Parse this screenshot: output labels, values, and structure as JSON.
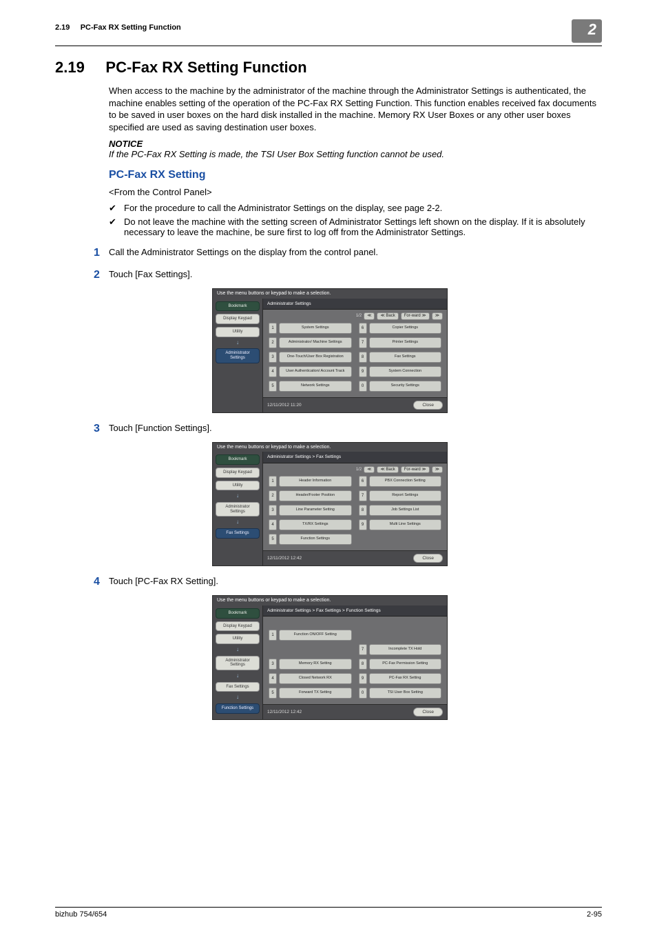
{
  "running_head": {
    "section_no": "2.19",
    "title": "PC-Fax RX Setting Function",
    "chapter_no": "2"
  },
  "heading": {
    "number": "2.19",
    "title": "PC-Fax RX Setting Function"
  },
  "intro_paragraph": "When access to the machine by the administrator of the machine through the Administrator Settings is authenticated, the machine enables setting of the operation of the PC-Fax RX Setting Function. This function enables received fax documents to be saved in user boxes on the hard disk installed in the machine. Memory RX User Boxes or any other user boxes specified are used as saving destination user boxes.",
  "notice_label": "NOTICE",
  "notice_text": "If the PC-Fax RX Setting is made, the TSI User Box Setting function cannot be used.",
  "subheading": "PC-Fax RX Setting",
  "from_panel": "<From the Control Panel>",
  "checks": [
    "For the procedure to call the Administrator Settings on the display, see page 2-2.",
    "Do not leave the machine with the setting screen of Administrator Settings left shown on the display. If it is absolutely necessary to leave the machine, be sure first to log off from the Administrator Settings."
  ],
  "steps": [
    {
      "num": "1",
      "text": "Call the Administrator Settings on the display from the control panel."
    },
    {
      "num": "2",
      "text": "Touch [Fax Settings]."
    },
    {
      "num": "3",
      "text": "Touch [Function Settings]."
    },
    {
      "num": "4",
      "text": "Touch [PC-Fax RX Setting]."
    }
  ],
  "panel_common": {
    "top_hint": "Use the menu buttons or keypad to make a selection.",
    "close": "Close"
  },
  "panel1": {
    "crumb": "Administrator Settings",
    "pager": "1/2",
    "pager_back": "Back",
    "side": {
      "bookmark": "Bookmark",
      "display_keypad": "Display Keypad",
      "utility": "Utility",
      "admin": "Administrator Settings"
    },
    "left": [
      {
        "n": "1",
        "label": "System Settings"
      },
      {
        "n": "2",
        "label": "Administrator/ Machine Settings"
      },
      {
        "n": "3",
        "label": "One-Touch/User Box Registration"
      },
      {
        "n": "4",
        "label": "User Authentication/ Account Track"
      },
      {
        "n": "5",
        "label": "Network Settings"
      }
    ],
    "right": [
      {
        "n": "6",
        "label": "Copier Settings"
      },
      {
        "n": "7",
        "label": "Printer Settings"
      },
      {
        "n": "8",
        "label": "Fax Settings"
      },
      {
        "n": "9",
        "label": "System Connection"
      },
      {
        "n": "0",
        "label": "Security Settings"
      }
    ],
    "timestamp": "12/11/2012   11:20"
  },
  "panel2": {
    "crumb": "Administrator Settings  >  Fax Settings",
    "pager": "1/2",
    "pager_back": "Back",
    "side": {
      "bookmark": "Bookmark",
      "display_keypad": "Display Keypad",
      "utility": "Utility",
      "admin": "Administrator Settings",
      "fax": "Fax Settings"
    },
    "left": [
      {
        "n": "1",
        "label": "Header Information"
      },
      {
        "n": "2",
        "label": "Header/Footer Position"
      },
      {
        "n": "3",
        "label": "Line Parameter Setting"
      },
      {
        "n": "4",
        "label": "TX/RX Settings"
      },
      {
        "n": "5",
        "label": "Function Settings"
      }
    ],
    "right": [
      {
        "n": "6",
        "label": "PBX Connection Setting"
      },
      {
        "n": "7",
        "label": "Report Settings"
      },
      {
        "n": "8",
        "label": "Job Settings List"
      },
      {
        "n": "9",
        "label": "Multi Line Settings"
      }
    ],
    "timestamp": "12/11/2012   12:42"
  },
  "panel3": {
    "crumb": "Administrator Settings > Fax Settings > Function Settings",
    "side": {
      "bookmark": "Bookmark",
      "display_keypad": "Display Keypad",
      "utility": "Utility",
      "admin": "Administrator Settings",
      "fax": "Fax Settings",
      "func": "Function Settings"
    },
    "left": [
      {
        "n": "1",
        "label": "Function ON/OFF Setting"
      },
      {
        "n": "3",
        "label": "Memory RX Setting"
      },
      {
        "n": "4",
        "label": "Closed Network RX"
      },
      {
        "n": "5",
        "label": "Forward TX Setting"
      }
    ],
    "right": [
      {
        "n": "7",
        "label": "Incomplete TX Hold"
      },
      {
        "n": "8",
        "label": "PC-Fax Permission Setting"
      },
      {
        "n": "9",
        "label": "PC-Fax RX Setting"
      },
      {
        "n": "0",
        "label": "TSI User Box Setting"
      }
    ],
    "timestamp": "12/11/2012   12:42"
  },
  "footer": {
    "left": "bizhub 754/654",
    "right": "2-95"
  }
}
